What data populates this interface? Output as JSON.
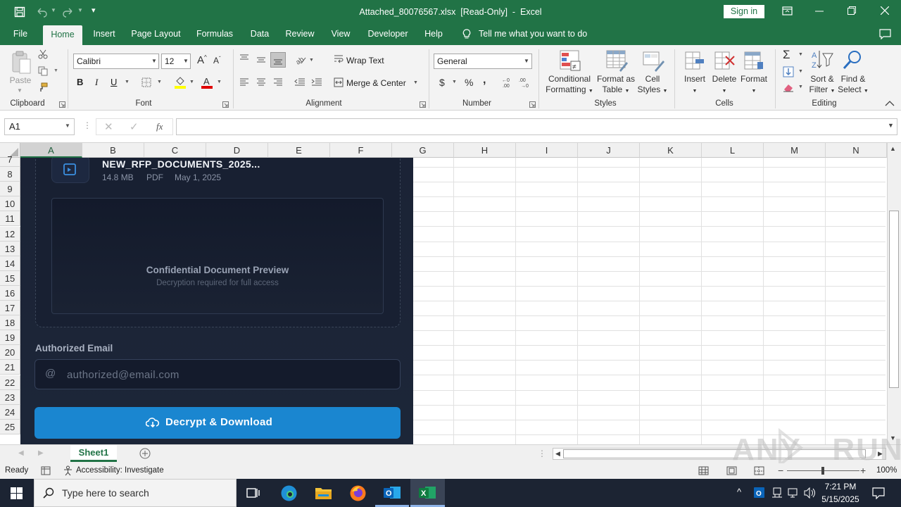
{
  "window": {
    "title": "Attached_80076567.xlsx  [Read-Only]  -  Excel",
    "sign_in": "Sign in"
  },
  "tabs": [
    {
      "label": "File"
    },
    {
      "label": "Home"
    },
    {
      "label": "Insert"
    },
    {
      "label": "Page Layout"
    },
    {
      "label": "Formulas"
    },
    {
      "label": "Data"
    },
    {
      "label": "Review"
    },
    {
      "label": "View"
    },
    {
      "label": "Developer"
    },
    {
      "label": "Help"
    }
  ],
  "tell_me": "Tell me what you want to do",
  "ribbon": {
    "clipboard": {
      "paste": "Paste",
      "label": "Clipboard"
    },
    "font": {
      "name": "Calibri",
      "size": "12",
      "bold": "B",
      "italic": "I",
      "underline": "U",
      "label": "Font"
    },
    "alignment": {
      "wrap": "Wrap Text",
      "merge": "Merge & Center",
      "label": "Alignment"
    },
    "number": {
      "format": "General",
      "currency": "$",
      "percent": "%",
      "comma": ",",
      "label": "Number"
    },
    "styles": {
      "conditional_1": "Conditional",
      "conditional_2": "Formatting",
      "table_1": "Format as",
      "table_2": "Table",
      "cell_1": "Cell",
      "cell_2": "Styles",
      "label": "Styles"
    },
    "cells": {
      "insert": "Insert",
      "delete": "Delete",
      "format": "Format",
      "label": "Cells"
    },
    "editing": {
      "sort_1": "Sort &",
      "sort_2": "Filter",
      "find_1": "Find &",
      "find_2": "Select",
      "label": "Editing"
    }
  },
  "formula_bar": {
    "name_box": "A1",
    "fx": "fx",
    "value": ""
  },
  "columns": [
    "A",
    "B",
    "C",
    "D",
    "E",
    "F",
    "G",
    "H",
    "I",
    "J",
    "K",
    "L",
    "M",
    "N"
  ],
  "rows": [
    "7",
    "8",
    "9",
    "10",
    "11",
    "12",
    "13",
    "14",
    "15",
    "16",
    "17",
    "18",
    "19",
    "20",
    "21",
    "22",
    "23",
    "24",
    "25"
  ],
  "overlay": {
    "file_name": "NEW_RFP_DOCUMENTS_2025...",
    "file_size": "14.8 MB",
    "file_type": "PDF",
    "file_date": "May 1, 2025",
    "preview_title": "Confidential Document Preview",
    "preview_sub": "Decryption required for full access",
    "email_label": "Authorized Email",
    "email_placeholder": "authorized@email.com",
    "button": "Decrypt & Download",
    "accent": "#1a86d0",
    "bg": "#1b2336"
  },
  "sheets": [
    {
      "label": "Sheet1"
    }
  ],
  "status": {
    "ready": "Ready",
    "accessibility": "Accessibility: Investigate",
    "zoom": "100%"
  },
  "watermark": "ANY RUN",
  "taskbar": {
    "search": "Type here to search",
    "time": "7:21 PM",
    "date": "5/15/2025"
  },
  "colors": {
    "excel_green": "#217346",
    "ribbon_bg": "#f3f3f3",
    "taskbar": "#1c2433"
  }
}
